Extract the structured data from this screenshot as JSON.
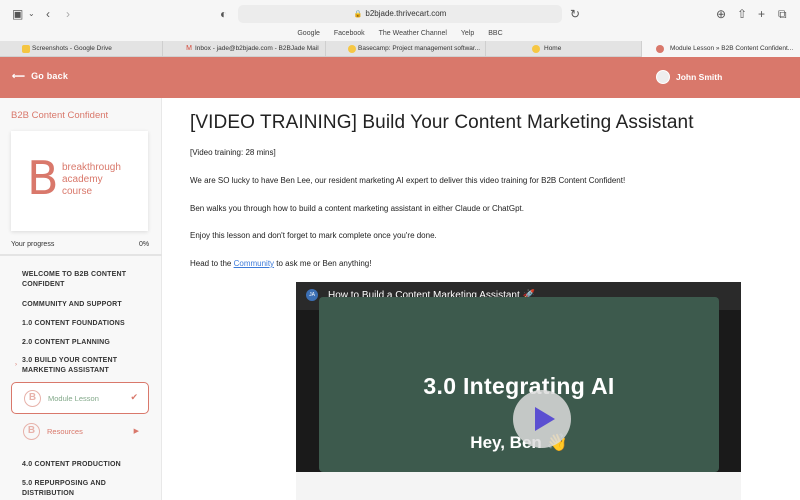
{
  "browser": {
    "url": "b2bjade.thrivecart.com",
    "bookmarks": [
      "Google",
      "Facebook",
      "The Weather Channel",
      "Yelp",
      "BBC"
    ],
    "tabs": [
      {
        "label": "Screenshots - Google Drive",
        "active": false
      },
      {
        "label": "Inbox - jade@b2bjade.com - B2BJade Mail",
        "active": false
      },
      {
        "label": "Basecamp: Project management softwar...",
        "active": false
      },
      {
        "label": "Home",
        "active": false
      },
      {
        "label": "Module Lesson » B2B Content Confident...",
        "active": true
      }
    ]
  },
  "header": {
    "back_label": "Go back",
    "user_name": "John Smith",
    "accent_color": "#d9786b"
  },
  "sidebar": {
    "course_title": "B2B Content Confident",
    "logo_letter": "B",
    "logo_lines": [
      "breakthrough",
      "academy",
      "course"
    ],
    "progress_label": "Your progress",
    "progress_value": "0%",
    "progress_fraction": 0,
    "items": [
      {
        "label": "WELCOME TO B2B CONTENT CONFIDENT"
      },
      {
        "label": "COMMUNITY AND SUPPORT"
      },
      {
        "label": "1.0 CONTENT FOUNDATIONS"
      },
      {
        "label": "2.0 CONTENT PLANNING"
      },
      {
        "label": "3.0 BUILD YOUR CONTENT MARKETING ASSISTANT",
        "expanded": true
      },
      {
        "label": "4.0 CONTENT PRODUCTION"
      },
      {
        "label": "5.0 REPURPOSING AND DISTRIBUTION"
      }
    ],
    "lessons": [
      {
        "label": "Module Lesson",
        "status": "completed",
        "icon": "check-icon"
      },
      {
        "label": "Resources",
        "status": "next",
        "icon": "play-arrow-icon"
      }
    ]
  },
  "main": {
    "title": "[VIDEO TRAINING] Build Your Content Marketing Assistant",
    "duration_text": "[Video training: 28 mins]",
    "para1": "We are SO lucky to have Ben Lee, our resident marketing AI expert to deliver this video training for B2B Content Confident!",
    "para2": "Ben walks you through how to build a content marketing assistant in either Claude or ChatGpt.",
    "para3": "Enjoy this lesson and don't forget to mark complete once you're done.",
    "para4_before": "Head to the ",
    "para4_link": "Community",
    "para4_after": " to ask me or Ben anything!",
    "video": {
      "title": "How to Build a Content Marketing Assistant 🚀",
      "channel_initials": "JA",
      "slide_heading": "3.0 Integrating AI",
      "slide_sub": "Hey, Ben 👋"
    }
  }
}
